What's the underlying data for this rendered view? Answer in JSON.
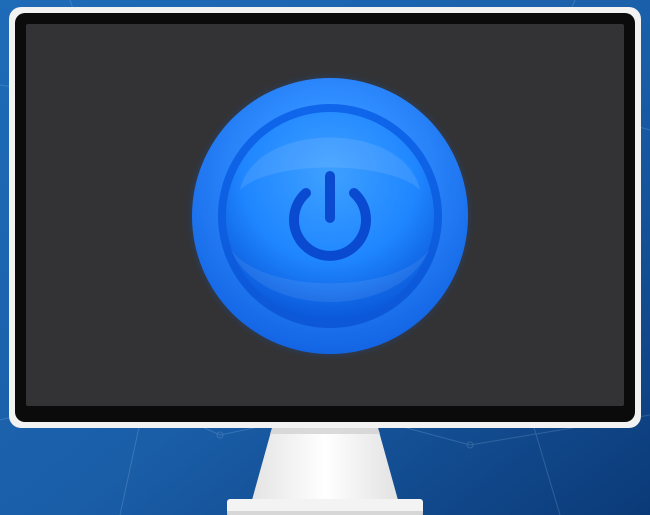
{
  "scene": {
    "subject": "desktop monitor",
    "icons": {
      "power": "power-icon"
    }
  },
  "colors": {
    "background_dark": "#0b3a78",
    "background_light": "#2a86d0",
    "bezel": "#0b0b0b",
    "bezel_frame": "#f2f2f2",
    "screen": "#333335",
    "stand": "#f3f3f3",
    "stand_shadow": "#d4d4d4",
    "button_outer": "#0f5fe0",
    "button_outer_light": "#4aa8ff",
    "button_inner": "#1f86ff",
    "button_core": "#2b93ff",
    "icon": "#0a4ad0"
  }
}
